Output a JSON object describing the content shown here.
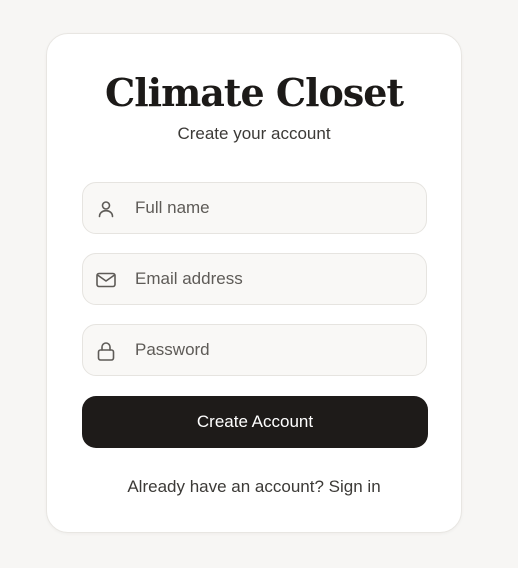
{
  "brand": {
    "title": "Climate Closet",
    "subtitle": "Create your account"
  },
  "form": {
    "full_name": {
      "placeholder": "Full name",
      "value": "",
      "icon": "user-icon"
    },
    "email": {
      "placeholder": "Email address",
      "value": "",
      "icon": "mail-icon"
    },
    "password": {
      "placeholder": "Password",
      "value": "",
      "icon": "lock-icon"
    },
    "submit_label": "Create Account"
  },
  "footer": {
    "prompt": "Already have an account?",
    "link_label": "Sign in"
  },
  "colors": {
    "background": "#f7f6f4",
    "card": "#ffffff",
    "primary_button": "#1e1b19",
    "input_background": "#f9f8f6",
    "text": "#1c1a18"
  }
}
